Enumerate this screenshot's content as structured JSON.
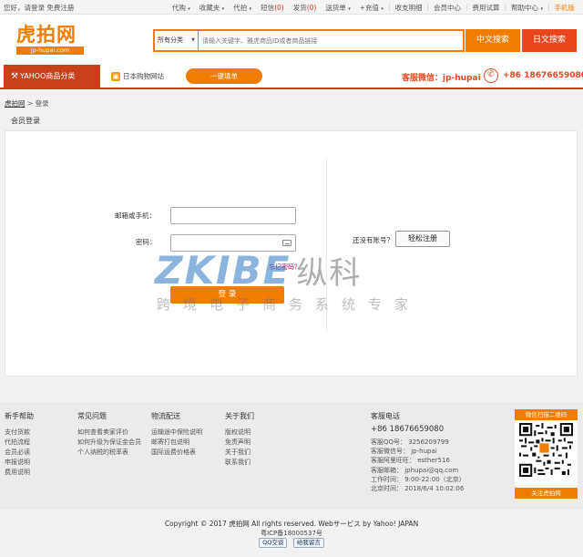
{
  "topbar": {
    "greeting": "您好，请登录 免费注册",
    "nav": [
      {
        "label": "代购",
        "arrow": "▾"
      },
      {
        "label": "收藏夹",
        "arrow": "▾"
      },
      {
        "label": "代拍",
        "arrow": "▾"
      },
      {
        "label": "短信",
        "count": "(0)"
      },
      {
        "label": "发货",
        "count": "(0)"
      },
      {
        "label": "送货单",
        "arrow": "▾"
      },
      {
        "label": "+充值",
        "arrow": "▾"
      },
      {
        "label": "收支明细"
      },
      {
        "label": "会员中心"
      },
      {
        "label": "费用试算"
      },
      {
        "label": "帮助中心",
        "arrow": "▾"
      },
      {
        "label": "手机版"
      }
    ]
  },
  "header": {
    "logo_cn": "虎拍网",
    "logo_en": "jp-hupai.com",
    "category_select": "所有分类",
    "search_placeholder": "请输入关键字、雅虎商品ID或者商品链接",
    "btn_cn_search": "中文搜索",
    "btn_jp_search": "日文搜索"
  },
  "navbar": {
    "category_tab": "YAHOO商品分类",
    "jp_link": "日本购物网站",
    "quick_order": "一键填单",
    "wechat": "客服微信：jp-hupai",
    "phone": "+86 18676659080"
  },
  "breadcrumb": {
    "home": "虎拍网",
    "sep": ">",
    "current": "登录"
  },
  "login": {
    "panel_title": "会员登录",
    "email_label": "邮箱或手机：",
    "password_label": "密码：",
    "forgot": "忘记密码？",
    "submit": "登 录",
    "no_account": "还没有账号？",
    "register": "轻松注册"
  },
  "watermark": {
    "brand": "ZKIBE",
    "brand_cn": "纵科",
    "tagline": "跨境电子商务系统专家"
  },
  "footer": {
    "columns": [
      {
        "title": "新手帮助",
        "items": [
          "支付货款",
          "代拍流程",
          "会员必读",
          "申报说明",
          "费用说明"
        ]
      },
      {
        "title": "常见问题",
        "items": [
          "如何查看卖家评价",
          "如何升级为保证金会员",
          "个人纳税的税率表"
        ]
      },
      {
        "title": "物流配送",
        "items": [
          "运输途中保险说明",
          "邮寄打包说明",
          "国际运费价格表"
        ]
      },
      {
        "title": "关于我们",
        "items": [
          "版权说明",
          "免责声明",
          "关于我们",
          "联系我们"
        ]
      }
    ],
    "service": {
      "title": "客服电话",
      "tel": "+86 18676659080",
      "items": [
        "客服QQ号：  3256209799",
        "客服微信号：  jp-hupai",
        "客服阿里旺旺：  esther516",
        "客服邮箱：  jphupai@qq.com",
        "工作时间：  9:00-22:00（北京）",
        "北京时间：  2018/6/4 10:02:06"
      ]
    },
    "qr_top": "微信扫描二维码",
    "qr_bottom": "关注虎拍网"
  },
  "copyright": "Copyright © 2017 虎拍网 All rights reserved.   Webサービス by Yahoo! JAPAN",
  "icp": "粤ICP备18000537号",
  "badges": [
    "QQ交谈",
    "给我留言"
  ]
}
